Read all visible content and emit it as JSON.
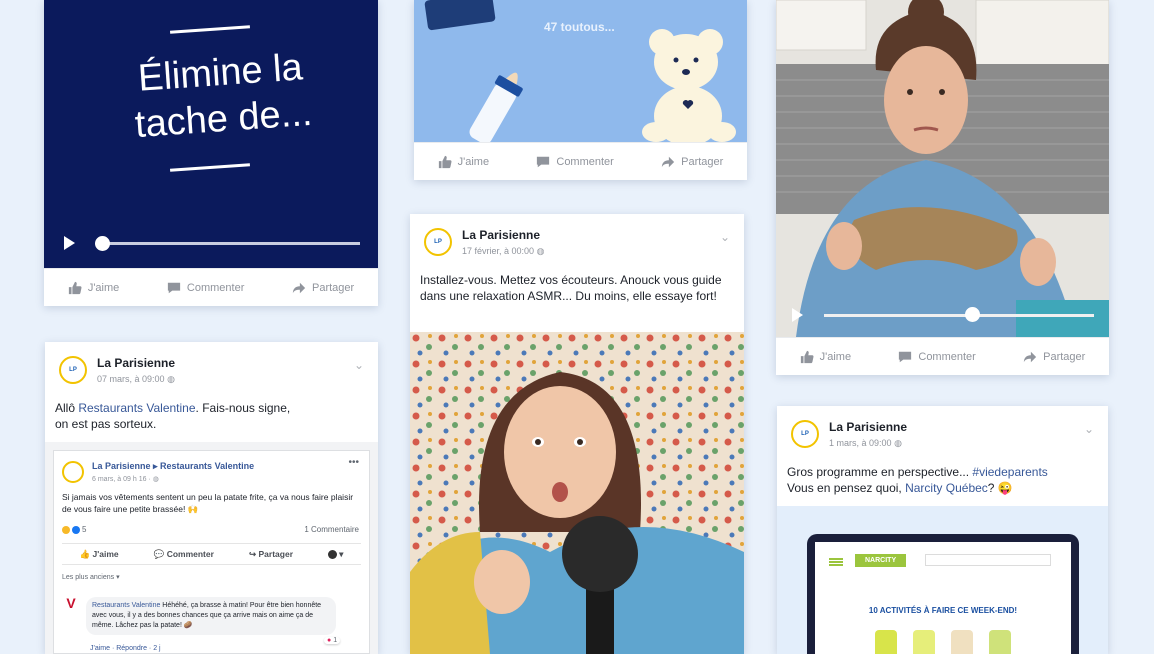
{
  "actions": {
    "like": "J'aime",
    "comment": "Commenter",
    "share": "Partager"
  },
  "card1": {
    "headline_line1": "Élimine la",
    "headline_line2": "tache de..."
  },
  "card2": {
    "caption": "47 toutous..."
  },
  "card3": {
    "page_name": "La Parisienne",
    "date": "17 février, à 00:00",
    "text": "Installez-vous. Mettez vos écouteurs. Anouck vous guide dans une relaxation ASMR... Du moins, elle essaye fort!"
  },
  "card5": {
    "page_name": "La Parisienne",
    "date": "07 mars, à 09:00",
    "text_prefix": "Allô ",
    "text_link": "Restaurants Valentine",
    "text_suffix": ". Fais-nous signe, on est pas sorteux.",
    "embed": {
      "header": "La Parisienne ▸ Restaurants Valentine",
      "date": "6 mars, à 09 h 16 · ",
      "text": "Si jamais vos vêtements sentent un peu la patate frite, ça va nous faire plaisir de vous faire une petite brassée! 🙌",
      "reactions_count": "5",
      "comments_count": "1 Commentaire",
      "like": "J'aime",
      "comment": "Commenter",
      "share": "Partager",
      "sort": "Les plus anciens ▾",
      "reply_author": "Restaurants Valentine",
      "reply_text": " Héhéhé, ça brasse à matin! Pour être bien honnête avec vous, il y a des bonnes chances que ça arrive mais on aime ça de même. Lâchez pas la patate! 🥔",
      "reply_actions": "J'aime · Répondre · 2 j",
      "reply_reactions": "1"
    }
  },
  "card6": {
    "page_name": "La Parisienne",
    "date": "1 mars, à 09:00",
    "text_line1_prefix": "Gros programme en perspective... ",
    "hashtag": "#viedeparents",
    "text_line2_prefix": "Vous en pensez quoi, ",
    "mention": "Narcity Québec",
    "text_line2_suffix": "? 😜",
    "screen_brand": "NARCITY",
    "screen_headline": "10 ACTIVITÉS À FAIRE CE WEEK-END!"
  },
  "colors": {
    "navy": "#0b1a5c",
    "light_blue": "#8fb9ec",
    "fb_link": "#385898"
  }
}
